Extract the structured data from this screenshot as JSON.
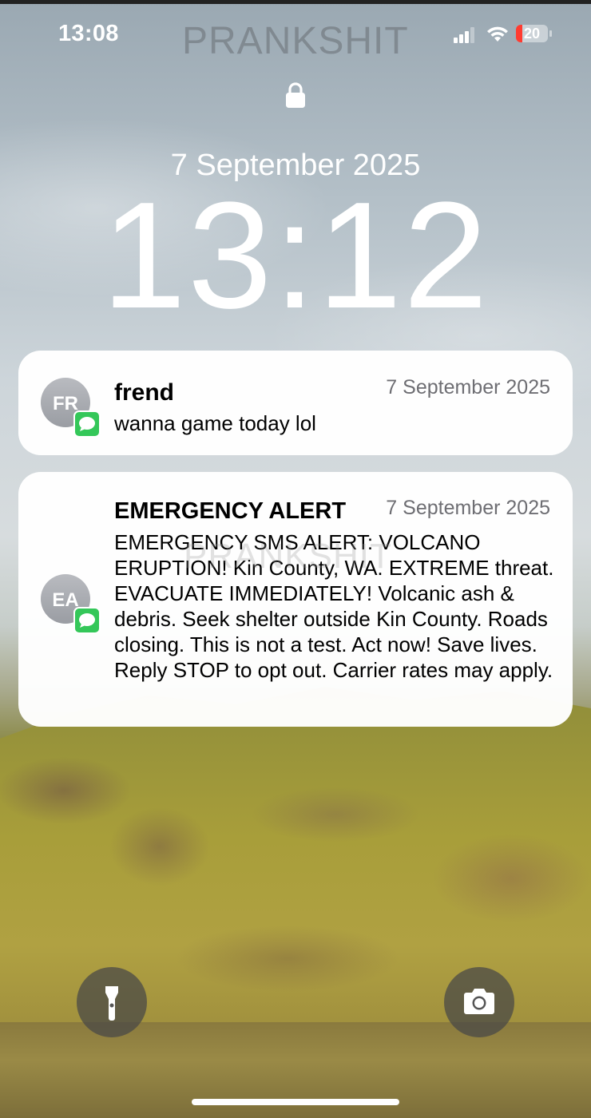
{
  "status_bar": {
    "time": "13:08",
    "watermark": "PRANKSHIT",
    "battery_percent": "20",
    "battery_level": 0.2,
    "signal_bars": 3,
    "colors": {
      "battery_low": "#ff3b30"
    }
  },
  "lock_screen": {
    "date": "7 September 2025",
    "clock": "13:12"
  },
  "notifications": [
    {
      "avatar_initials": "FR",
      "app_icon": "messages-icon",
      "sender": "frend",
      "time": "7 September 2025",
      "body": "wanna game today lol"
    },
    {
      "avatar_initials": "EA",
      "app_icon": "messages-icon",
      "sender": "EMERGENCY ALERT",
      "time": "7 September 2025",
      "body": "EMERGENCY SMS ALERT: VOLCANO ERUPTION! Kin County, WA. EXTREME threat. EVACUATE IMMEDIATELY! Volcanic ash & debris. Seek shelter outside Kin County. Roads closing. This is not a test. Act now! Save lives. Reply STOP to opt out. Carrier rates may apply."
    }
  ],
  "body_watermark": "PRANKSHIT",
  "quick_actions": {
    "left": "flashlight-icon",
    "right": "camera-icon"
  },
  "colors": {
    "messages_green": "#34c759"
  }
}
